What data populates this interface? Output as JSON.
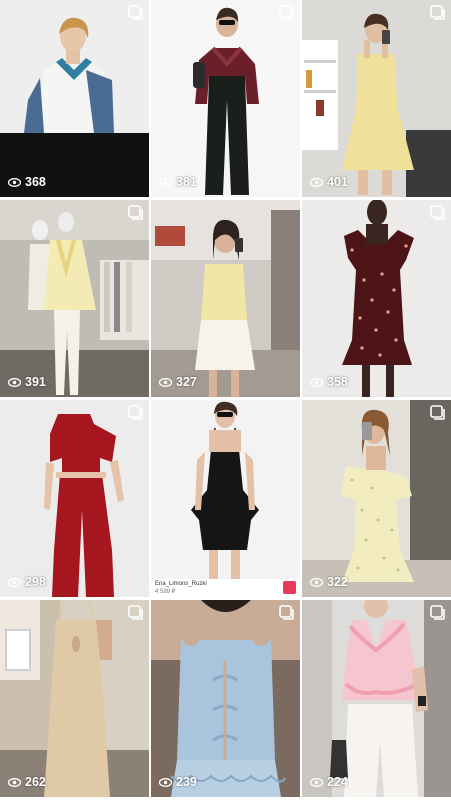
{
  "posts": [
    {
      "views": "368",
      "bg": "#f2f2f2",
      "bottom": "#111111"
    },
    {
      "views": "381",
      "bg": "#f6f6f6",
      "bottom": "#f4f4f4"
    },
    {
      "views": "401",
      "bg": "#dcdad6",
      "bottom": "#c9c4bd"
    },
    {
      "views": "391",
      "bg": "#bfbcb6",
      "bottom": "#6f6a64"
    },
    {
      "views": "327",
      "bg": "#cfcac3",
      "bottom": "#a39b91"
    },
    {
      "views": "358",
      "bg": "#ecebe9",
      "bottom": "#e2e1df"
    },
    {
      "views": "298",
      "bg": "#ececec",
      "bottom": "#e6e6e6"
    },
    {
      "views": "",
      "bg": "#f3f3f3",
      "bottom": "#efefef",
      "caption": "Ena_Limons_Ruzki",
      "price": "4 599 ₽"
    },
    {
      "views": "322",
      "bg": "#e3e0da",
      "bottom": "#c6c0b6"
    },
    {
      "views": "262",
      "bg": "#d9d0c4",
      "bottom": "#8c8177"
    },
    {
      "views": "239",
      "bg": "#7a6a5f",
      "bottom": "#5d5049"
    },
    {
      "views": "224",
      "bg": "#dedcda",
      "bottom": "#bdb9b5"
    }
  ],
  "colors": {
    "denim": "#4a6c93",
    "burgundy": "#6b1f2a",
    "butter": "#efe09a",
    "pale_yellow": "#f3eab4",
    "cream": "#ede3c8",
    "red": "#a5161f",
    "black": "#151515",
    "floral": "#f2ecc0",
    "sand": "#e0c9a6",
    "sky": "#a9c4dc",
    "pink": "#f5c6cf"
  },
  "icons": {
    "multi_post": "multiple-photos-icon",
    "views": "eye-icon",
    "gift": "gift-icon"
  }
}
